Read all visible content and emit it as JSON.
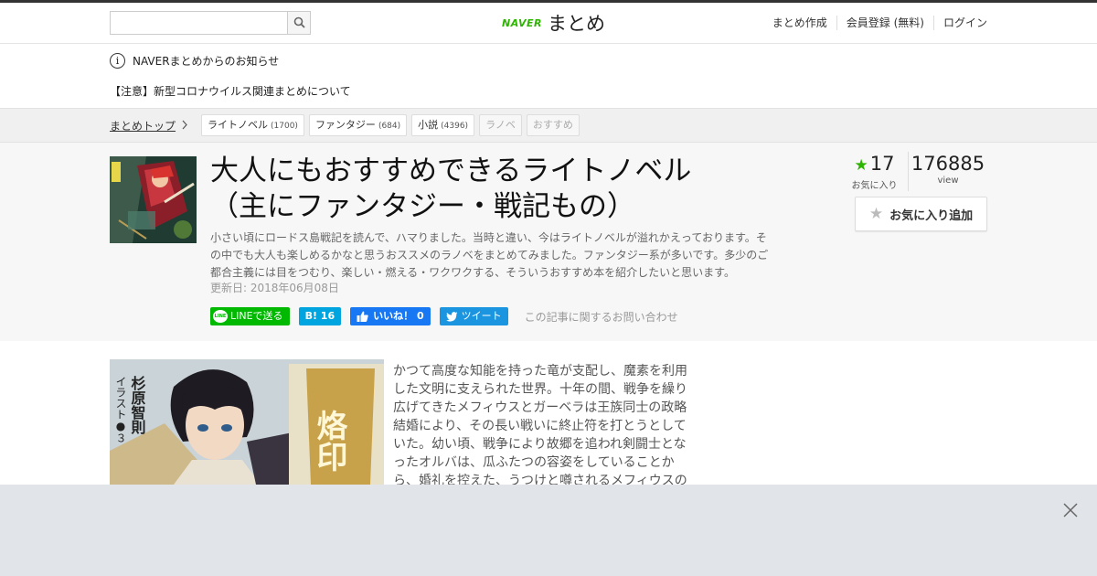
{
  "header": {
    "search": {
      "placeholder": "",
      "value": ""
    },
    "logo": {
      "naver": "NAVER",
      "matome": "まとめ"
    },
    "nav": [
      "まとめ作成",
      "会員登録 (無料)",
      "ログイン"
    ]
  },
  "notices": {
    "heading": "NAVERまとめからのお知らせ",
    "item": "【注意】新型コロナウイルス関連まとめについて"
  },
  "breadcrumb": {
    "label": "まとめトップ"
  },
  "tags": [
    {
      "label": "ライトノベル",
      "count": "(1700)"
    },
    {
      "label": "ファンタジー",
      "count": "(684)"
    },
    {
      "label": "小説",
      "count": "(4396)"
    },
    {
      "label": "ラノベ",
      "count": ""
    },
    {
      "label": "おすすめ",
      "count": ""
    }
  ],
  "article": {
    "title_line1": "大人にもおすすめできるライトノベル",
    "title_line2": "（主にファンタジー・戦記もの）",
    "description": "小さい頃にロードス島戦記を読んで、ハマりました。当時と違い、今はライトノベルが溢れかえっております。その中でも大人も楽しめるかなと思うおススメのラノベをまとめてみました。ファンタジー系が多いです。多少のご都合主義には目をつむり、楽しい・燃える・ワクワクする、そういうおすすめ本を紹介したいと思います。",
    "updated": "更新日: 2018年06月08日",
    "favorites_count": "17",
    "favorites_label": "お気に入り",
    "views_count": "176885",
    "views_label": "view",
    "fav_button": "お気に入り追加"
  },
  "share": {
    "line_icon": "LINE",
    "line": "LINEで送る",
    "hatena": "B! 16",
    "fb": "いいね！ 0",
    "tw": "ツイート",
    "contact": "この記事に関するお問い合わせ"
  },
  "content": {
    "cover_text_author": "杉原智則",
    "cover_text_illust": "イラスト●３",
    "cover_text_title": "烙印",
    "body": "かつて高度な知能を持った竜が支配し、魔素を利用した文明に支えられた世界。十年の間、戦争を繰り広げてきたメフィウスとガーベラは王族同士の政略結婚により、その長い戦いに終止符を打とうとしていた。幼い頃、戦争により故郷を追われ剣闘士となったオルバは、瓜ふたつの容姿をしていることから、婚礼を控えた、うつけと噂されるメフィウスの"
  },
  "colors": {
    "accent_green": "#2db400",
    "line_green": "#00b900",
    "hatena_blue": "#00a4de",
    "fb_blue": "#1877f2",
    "tw_blue": "#1b95e0"
  }
}
